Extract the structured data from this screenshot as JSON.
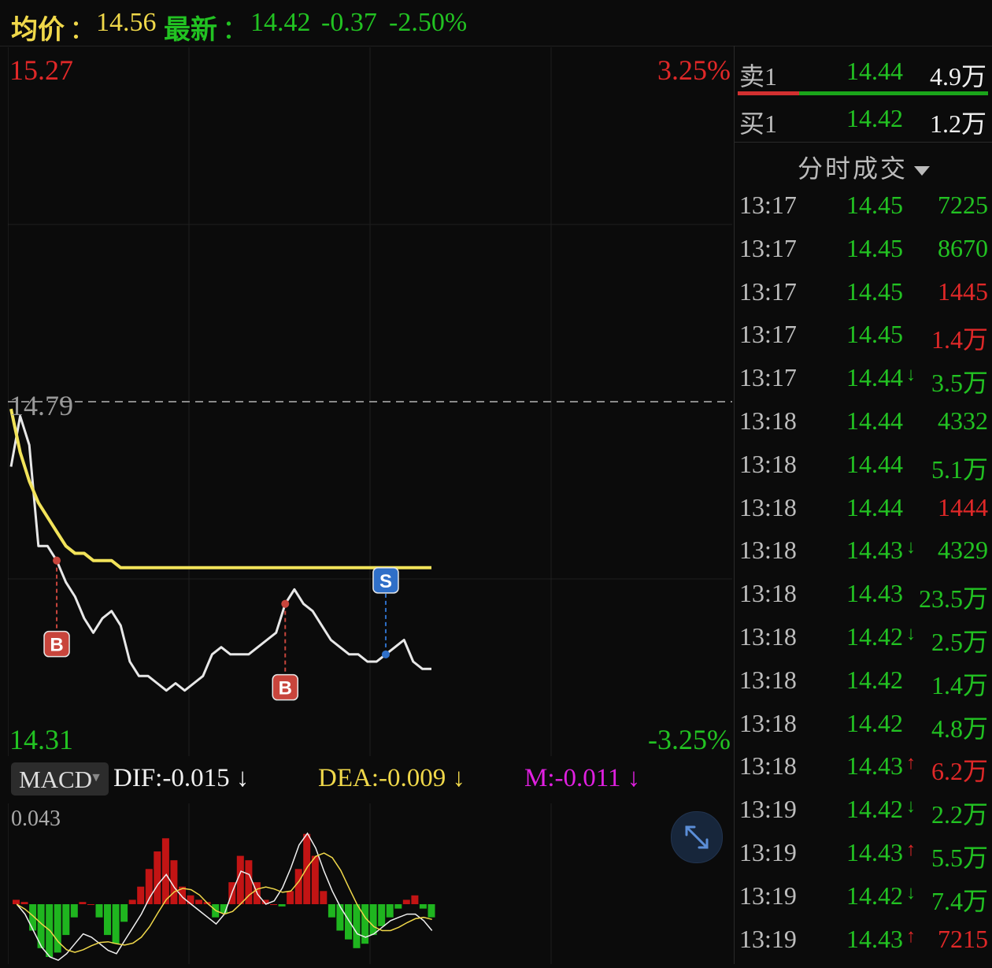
{
  "header": {
    "avg_label": "均价",
    "avg_sep": "：",
    "avg_value": "14.56",
    "latest_label": "最新",
    "latest_sep": "：",
    "latest_value": "14.42",
    "change": "-0.37",
    "change_pct": "-2.50%"
  },
  "chart": {
    "y_high": "15.27",
    "y_low": "14.31",
    "pct_high": "3.25%",
    "pct_low": "-3.25%",
    "ref_price": "14.79",
    "markers": [
      {
        "label": "B",
        "kind": "buy"
      },
      {
        "label": "B",
        "kind": "buy"
      },
      {
        "label": "S",
        "kind": "sell"
      }
    ]
  },
  "chart_data": [
    {
      "type": "line",
      "title": "",
      "y_range": [
        14.31,
        15.27
      ],
      "pct_range": [
        "-3.25%",
        "3.25%"
      ],
      "reference_line": 14.79,
      "series": [
        {
          "role": "price",
          "color": "#e8e8e8",
          "values": [
            14.7,
            14.77,
            14.73,
            14.59,
            14.59,
            14.57,
            14.54,
            14.52,
            14.49,
            14.47,
            14.49,
            14.5,
            14.48,
            14.43,
            14.41,
            14.41,
            14.4,
            14.39,
            14.4,
            14.39,
            14.4,
            14.41,
            14.44,
            14.45,
            14.44,
            14.44,
            14.44,
            14.45,
            14.46,
            14.47,
            14.51,
            14.53,
            14.51,
            14.5,
            14.48,
            14.46,
            14.45,
            14.44,
            14.44,
            14.43,
            14.43,
            14.44,
            14.45,
            14.46,
            14.43,
            14.42,
            14.42
          ]
        },
        {
          "role": "average",
          "color": "#f2e35a",
          "values": [
            14.78,
            14.72,
            14.68,
            14.65,
            14.63,
            14.61,
            14.59,
            14.58,
            14.58,
            14.57,
            14.57,
            14.57,
            14.56,
            14.56,
            14.56,
            14.56,
            14.56,
            14.56,
            14.56,
            14.56,
            14.56,
            14.56,
            14.56,
            14.56,
            14.56,
            14.56,
            14.56,
            14.56,
            14.56,
            14.56,
            14.56,
            14.56,
            14.56,
            14.56,
            14.56,
            14.56,
            14.56,
            14.56,
            14.56,
            14.56,
            14.56,
            14.56,
            14.56,
            14.56,
            14.56,
            14.56,
            14.56
          ]
        }
      ]
    },
    {
      "type": "bar",
      "title": "MACD",
      "y_top_label": "0.043",
      "series": [
        {
          "name": "M",
          "values": [
            0.002,
            0.001,
            -0.012,
            -0.02,
            -0.024,
            -0.022,
            -0.014,
            -0.006,
            0.001,
            0.0,
            -0.006,
            -0.014,
            -0.018,
            -0.008,
            0.002,
            0.008,
            0.016,
            0.024,
            0.03,
            0.02,
            0.008,
            0.004,
            0.002,
            0.001,
            -0.006,
            -0.004,
            0.01,
            0.022,
            0.02,
            0.01,
            0.002,
            0.0,
            -0.001,
            0.006,
            0.016,
            0.032,
            0.022,
            0.006,
            -0.006,
            -0.012,
            -0.016,
            -0.02,
            -0.018,
            -0.014,
            -0.01,
            -0.006,
            -0.002,
            0.002,
            0.004,
            -0.002,
            -0.006
          ]
        }
      ]
    }
  ],
  "macd": {
    "select_label": "MACD",
    "dif": "DIF:-0.015 ↓",
    "dea": "DEA:-0.009 ↓",
    "m": "M:-0.011 ↓",
    "top_value": "0.043"
  },
  "orderbook": {
    "ask": {
      "label": "卖1",
      "price": "14.44",
      "volume": "4.9万"
    },
    "bid": {
      "label": "买1",
      "price": "14.42",
      "volume": "1.2万"
    }
  },
  "ticks_header": "分时成交",
  "ticks": [
    {
      "time": "13:17",
      "price": "14.45",
      "arrow": "",
      "vol": "7225",
      "vol_color": "#22c222"
    },
    {
      "time": "13:17",
      "price": "14.45",
      "arrow": "",
      "vol": "8670",
      "vol_color": "#22c222"
    },
    {
      "time": "13:17",
      "price": "14.45",
      "arrow": "",
      "vol": "1445",
      "vol_color": "#e02828"
    },
    {
      "time": "13:17",
      "price": "14.45",
      "arrow": "",
      "vol": "1.4万",
      "vol_color": "#e02828"
    },
    {
      "time": "13:17",
      "price": "14.44",
      "arrow": "↓",
      "vol": "3.5万",
      "vol_color": "#22c222"
    },
    {
      "time": "13:18",
      "price": "14.44",
      "arrow": "",
      "vol": "4332",
      "vol_color": "#22c222"
    },
    {
      "time": "13:18",
      "price": "14.44",
      "arrow": "",
      "vol": "5.1万",
      "vol_color": "#22c222"
    },
    {
      "time": "13:18",
      "price": "14.44",
      "arrow": "",
      "vol": "1444",
      "vol_color": "#e02828"
    },
    {
      "time": "13:18",
      "price": "14.43",
      "arrow": "↓",
      "vol": "4329",
      "vol_color": "#22c222"
    },
    {
      "time": "13:18",
      "price": "14.43",
      "arrow": "",
      "vol": "23.5万",
      "vol_color": "#22c222"
    },
    {
      "time": "13:18",
      "price": "14.42",
      "arrow": "↓",
      "vol": "2.5万",
      "vol_color": "#22c222"
    },
    {
      "time": "13:18",
      "price": "14.42",
      "arrow": "",
      "vol": "1.4万",
      "vol_color": "#22c222"
    },
    {
      "time": "13:18",
      "price": "14.42",
      "arrow": "",
      "vol": "4.8万",
      "vol_color": "#22c222"
    },
    {
      "time": "13:18",
      "price": "14.43",
      "arrow": "↑",
      "vol": "6.2万",
      "vol_color": "#e02828"
    },
    {
      "time": "13:19",
      "price": "14.42",
      "arrow": "↓",
      "vol": "2.2万",
      "vol_color": "#22c222"
    },
    {
      "time": "13:19",
      "price": "14.43",
      "arrow": "↑",
      "vol": "5.5万",
      "vol_color": "#22c222"
    },
    {
      "time": "13:19",
      "price": "14.42",
      "arrow": "↓",
      "vol": "7.4万",
      "vol_color": "#22c222"
    },
    {
      "time": "13:19",
      "price": "14.43",
      "arrow": "↑",
      "vol": "7215",
      "vol_color": "#e02828"
    }
  ],
  "colors": {
    "up": "#e02828",
    "down": "#22c222",
    "avg_line": "#f2e35a",
    "header_yellow": "#f0d84a",
    "magenta": "#e020e0"
  }
}
